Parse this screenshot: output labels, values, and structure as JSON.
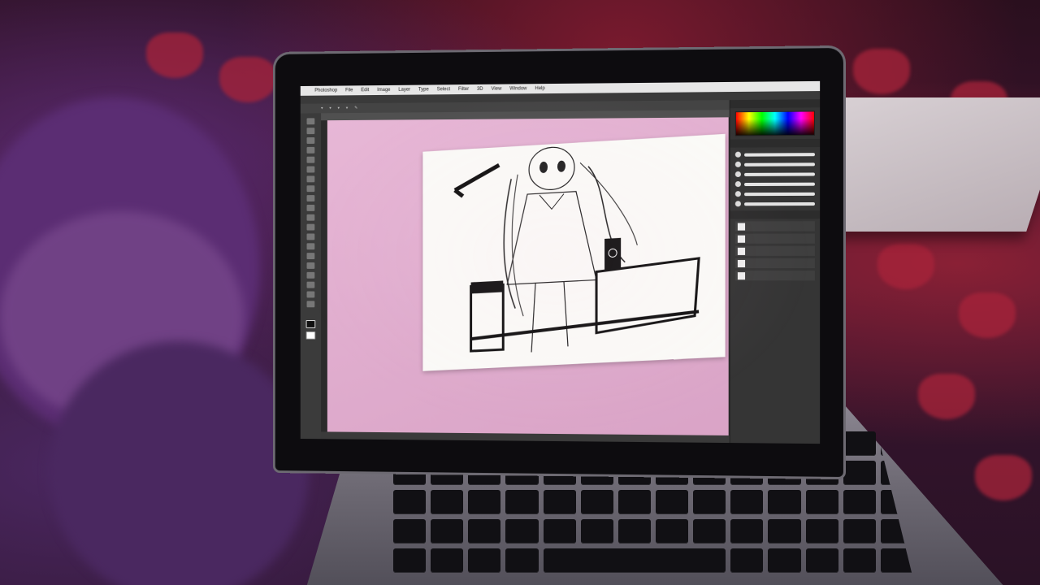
{
  "scene": {
    "description_colors": {
      "blanket_purple": "#5a2a70",
      "blanket_red": "#a8233a",
      "pasteboard_pink": "#e7b7d6"
    }
  },
  "app": {
    "menubar": [
      "Photoshop",
      "File",
      "Edit",
      "Image",
      "Layer",
      "Type",
      "Select",
      "Filter",
      "3D",
      "View",
      "Window",
      "Help"
    ]
  }
}
